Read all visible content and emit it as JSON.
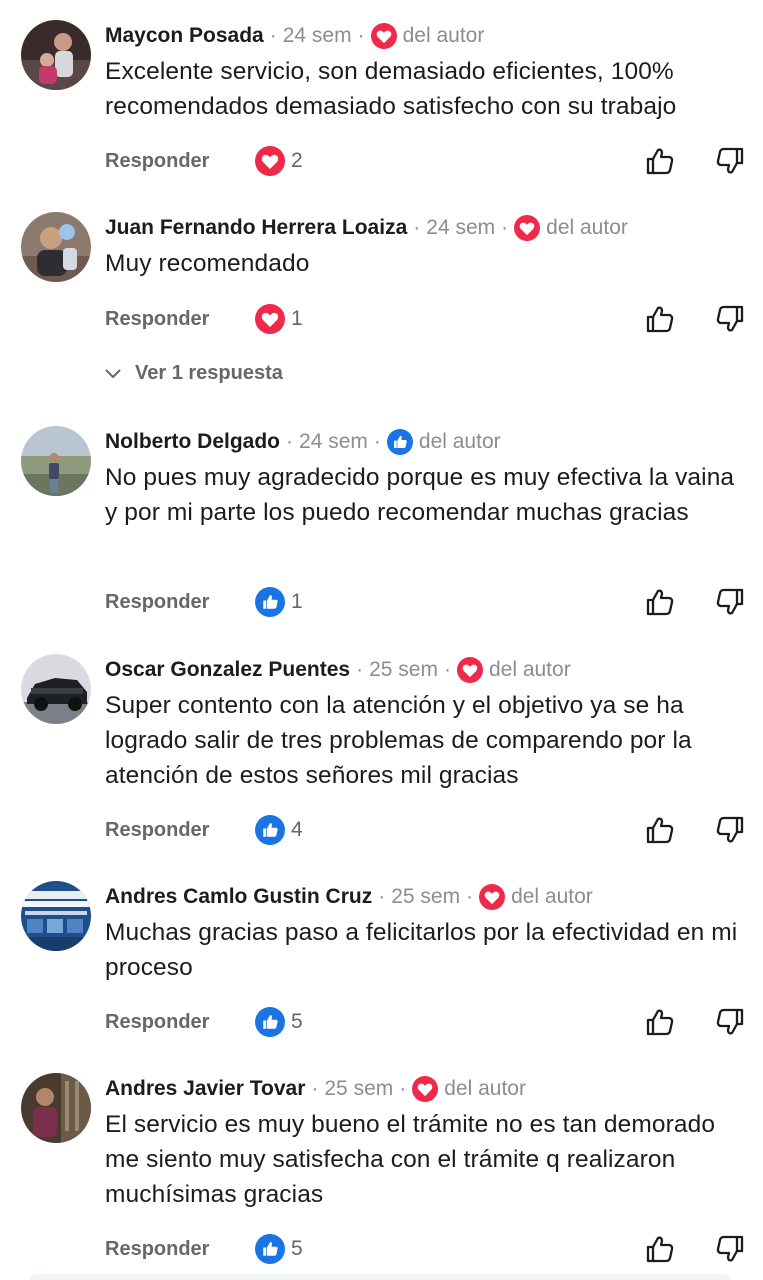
{
  "common": {
    "separator": "·",
    "author_label": "del autor",
    "reply_label": "Responder"
  },
  "colors": {
    "love": "#f0284a",
    "like": "#1b74e4",
    "secondary_text": "#65676b"
  },
  "comments": [
    {
      "name": "Maycon Posada",
      "time": "24 sem",
      "author_reaction": "love",
      "text": "Excelente servicio, son demasiado eficientes, 100% recomendados demasiado satisfecho con su trabajo",
      "reaction_type": "love",
      "reaction_count": "2"
    },
    {
      "name": "Juan Fernando Herrera Loaiza",
      "time": "24 sem",
      "author_reaction": "love",
      "text": "Muy recomendado",
      "reaction_type": "love",
      "reaction_count": "1",
      "replies_label": "Ver 1 respuesta"
    },
    {
      "name": "Nolberto Delgado",
      "time": "24 sem",
      "author_reaction": "like",
      "text": "No pues muy agradecido porque es muy efectiva la vaina y por mi parte los puedo recomendar muchas gracias",
      "reaction_type": "like",
      "reaction_count": "1"
    },
    {
      "name": "Oscar Gonzalez Puentes",
      "time": "25 sem",
      "author_reaction": "love",
      "text": "Super contento con la atención y el objetivo ya se ha logrado salir de tres problemas de comparendo por la atención de estos señores mil gracias",
      "reaction_type": "like",
      "reaction_count": "4"
    },
    {
      "name": "Andres Camlo Gustin Cruz",
      "time": "25 sem",
      "author_reaction": "love",
      "text": "Muchas gracias paso a felicitarlos por la efectividad en mi proceso",
      "reaction_type": "like",
      "reaction_count": "5"
    },
    {
      "name": "Andres Javier Tovar",
      "time": "25 sem",
      "author_reaction": "love",
      "text": "El servicio es muy bueno el trámite no es tan demorado me siento muy satisfecha con el trámite q realizaron muchísimas gracias",
      "reaction_type": "like",
      "reaction_count": "5"
    }
  ]
}
